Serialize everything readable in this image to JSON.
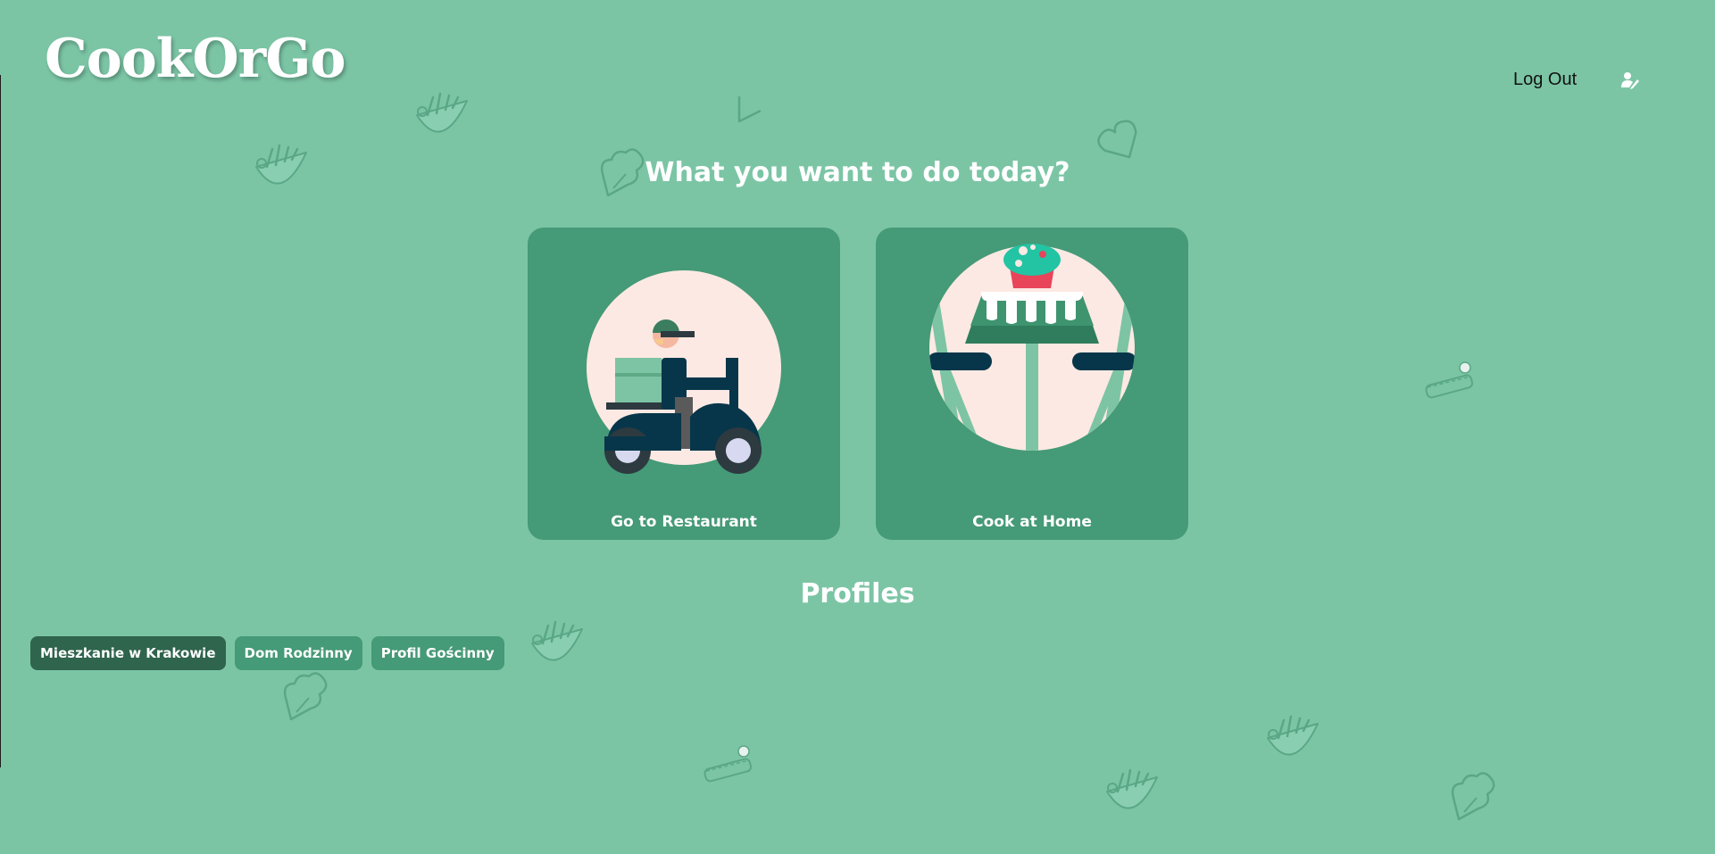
{
  "app": {
    "title": "CookOrGo"
  },
  "header": {
    "logout_label": "Log Out",
    "profile_icon": "user-edit-icon"
  },
  "main": {
    "question": "What you want to do today?",
    "options": [
      {
        "label": "Go to Restaurant",
        "icon": "delivery-scooter-icon"
      },
      {
        "label": "Cook at Home",
        "icon": "dining-table-icon"
      }
    ]
  },
  "profiles": {
    "title": "Profiles",
    "items": [
      {
        "label": "Mieszkanie w Krakowie",
        "active": true
      },
      {
        "label": "Dom Rodzinny",
        "active": false
      },
      {
        "label": "Profil Gościnny",
        "active": false
      }
    ]
  },
  "colors": {
    "background": "#7bc5a5",
    "card": "#459a77",
    "active_profile": "#2f644d",
    "inactive_profile": "#459a77",
    "text": "#ffffff"
  }
}
